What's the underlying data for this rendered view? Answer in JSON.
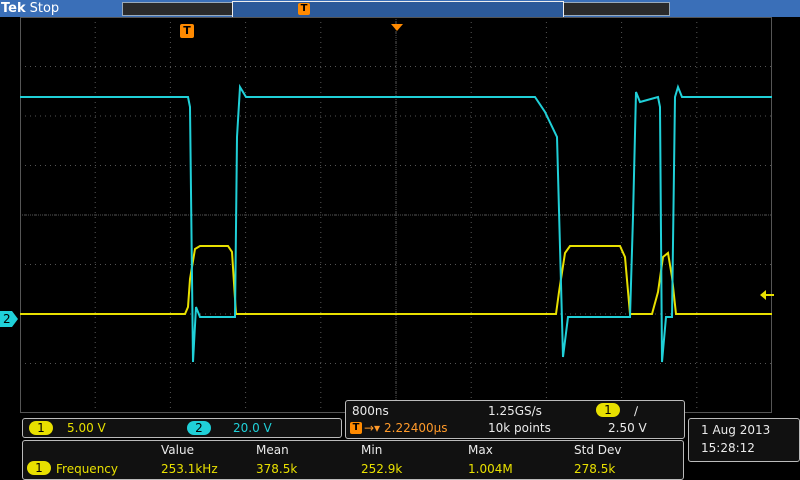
{
  "header": {
    "brand": "Tek",
    "status": "Stop"
  },
  "markers": {
    "trigger_glyph": "T",
    "ch2_label": "2"
  },
  "channel1": {
    "label": "1",
    "scale": "5.00 V",
    "color": "#e8e000"
  },
  "channel2": {
    "label": "2",
    "scale": "20.0 V",
    "color": "#20d0d8"
  },
  "timebase": {
    "time_per_div": "800ns",
    "sample_rate": "1.25GS/s",
    "trigger_delay": "2.22400µs",
    "record_length": "10k points",
    "trigger_source": "1",
    "trigger_slope": "∕",
    "trigger_level": "2.50 V"
  },
  "datetime": {
    "date": "1 Aug 2013",
    "time": "15:28:12"
  },
  "measurement": {
    "headers": [
      "Value",
      "Mean",
      "Min",
      "Max",
      "Std Dev"
    ],
    "source": "1",
    "name": "Frequency",
    "values": [
      "253.1kHz",
      "378.5k",
      "252.9k",
      "1.004M",
      "278.5k"
    ]
  },
  "colors": {
    "accent": "#3a6fb8",
    "trigger": "#ff8a00",
    "grid": "#555555"
  }
}
